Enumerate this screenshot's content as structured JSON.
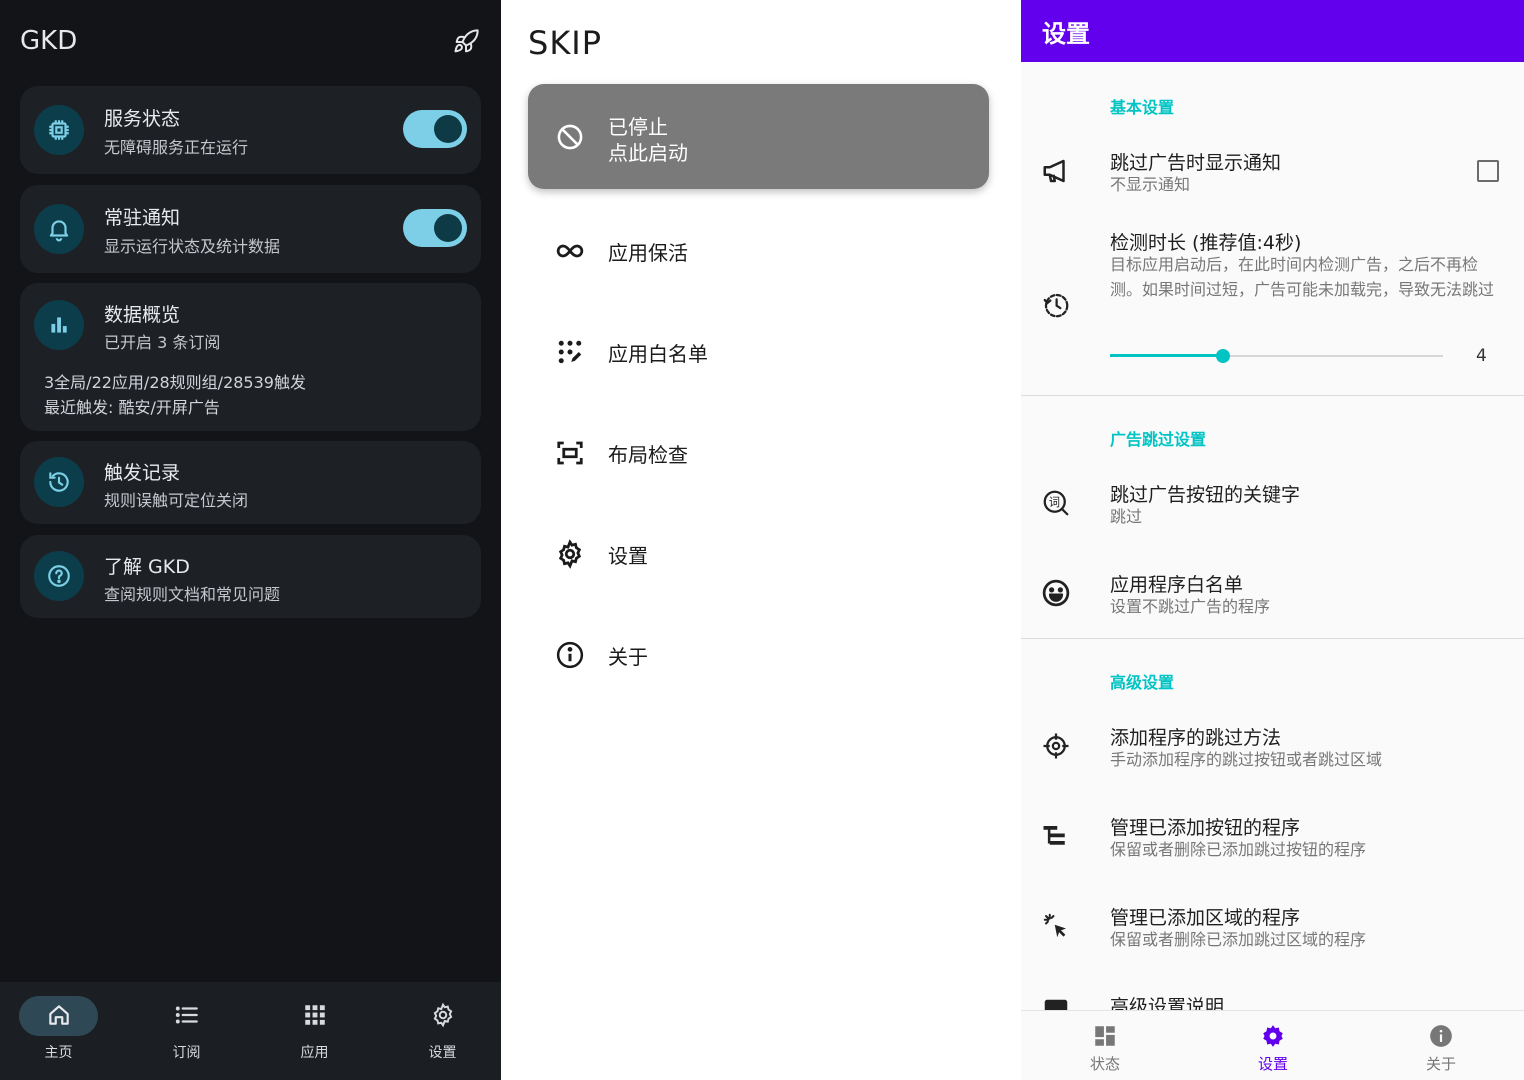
{
  "gkd": {
    "title": "GKD",
    "cards": {
      "service": {
        "title": "服务状态",
        "sub": "无障碍服务正在运行",
        "toggle_on": true
      },
      "notify": {
        "title": "常驻通知",
        "sub": "显示运行状态及统计数据",
        "toggle_on": true
      },
      "overview": {
        "title": "数据概览",
        "sub": "已开启 3 条订阅",
        "line1": "3全局/22应用/28规则组/28539触发",
        "line2": "最近触发: 酷安/开屏广告"
      },
      "history": {
        "title": "触发记录",
        "sub": "规则误触可定位关闭"
      },
      "about": {
        "title": "了解 GKD",
        "sub": "查阅规则文档和常见问题"
      }
    },
    "nav": {
      "home": "主页",
      "subs": "订阅",
      "apps": "应用",
      "settings": "设置",
      "active": "home"
    },
    "colors": {
      "accent": "#7ccfe6",
      "background": "#121418",
      "card": "#1d2126"
    }
  },
  "skip": {
    "title": "SKIP",
    "status": {
      "line1": "已停止",
      "line2": "点此启动"
    },
    "menu": {
      "keepalive": "应用保活",
      "whitelist": "应用白名单",
      "inspect": "布局检查",
      "settings": "设置",
      "about": "关于"
    }
  },
  "settings": {
    "title": "设置",
    "sections": {
      "basic": "基本设置",
      "ad": "广告跳过设置",
      "advanced": "高级设置"
    },
    "rows": {
      "notify": {
        "title": "跳过广告时显示通知",
        "sub": "不显示通知",
        "checked": false
      },
      "duration": {
        "title": "检测时长 (推荐值:4秒)",
        "sub": "目标应用启动后，在此时间内检测广告，之后不再检测。如果时间过短，广告可能未加载完，导致无法跳过",
        "value": "4",
        "slider_fraction": 0.34
      },
      "keyword": {
        "title": "跳过广告按钮的关键字",
        "sub": "跳过"
      },
      "whitelist": {
        "title": "应用程序白名单",
        "sub": "设置不跳过广告的程序"
      },
      "add_method": {
        "title": "添加程序的跳过方法",
        "sub": "手动添加程序的跳过按钮或者跳过区域"
      },
      "manage_buttons": {
        "title": "管理已添加按钮的程序",
        "sub": "保留或者删除已添加跳过按钮的程序"
      },
      "manage_areas": {
        "title": "管理已添加区域的程序",
        "sub": "保留或者删除已添加跳过区域的程序"
      },
      "advanced_help": {
        "title": "高级设置说明"
      }
    },
    "nav": {
      "status": "状态",
      "settings": "设置",
      "about": "关于",
      "active": "settings"
    },
    "colors": {
      "appbar": "#6200ee",
      "accent": "#03c4c4"
    }
  }
}
